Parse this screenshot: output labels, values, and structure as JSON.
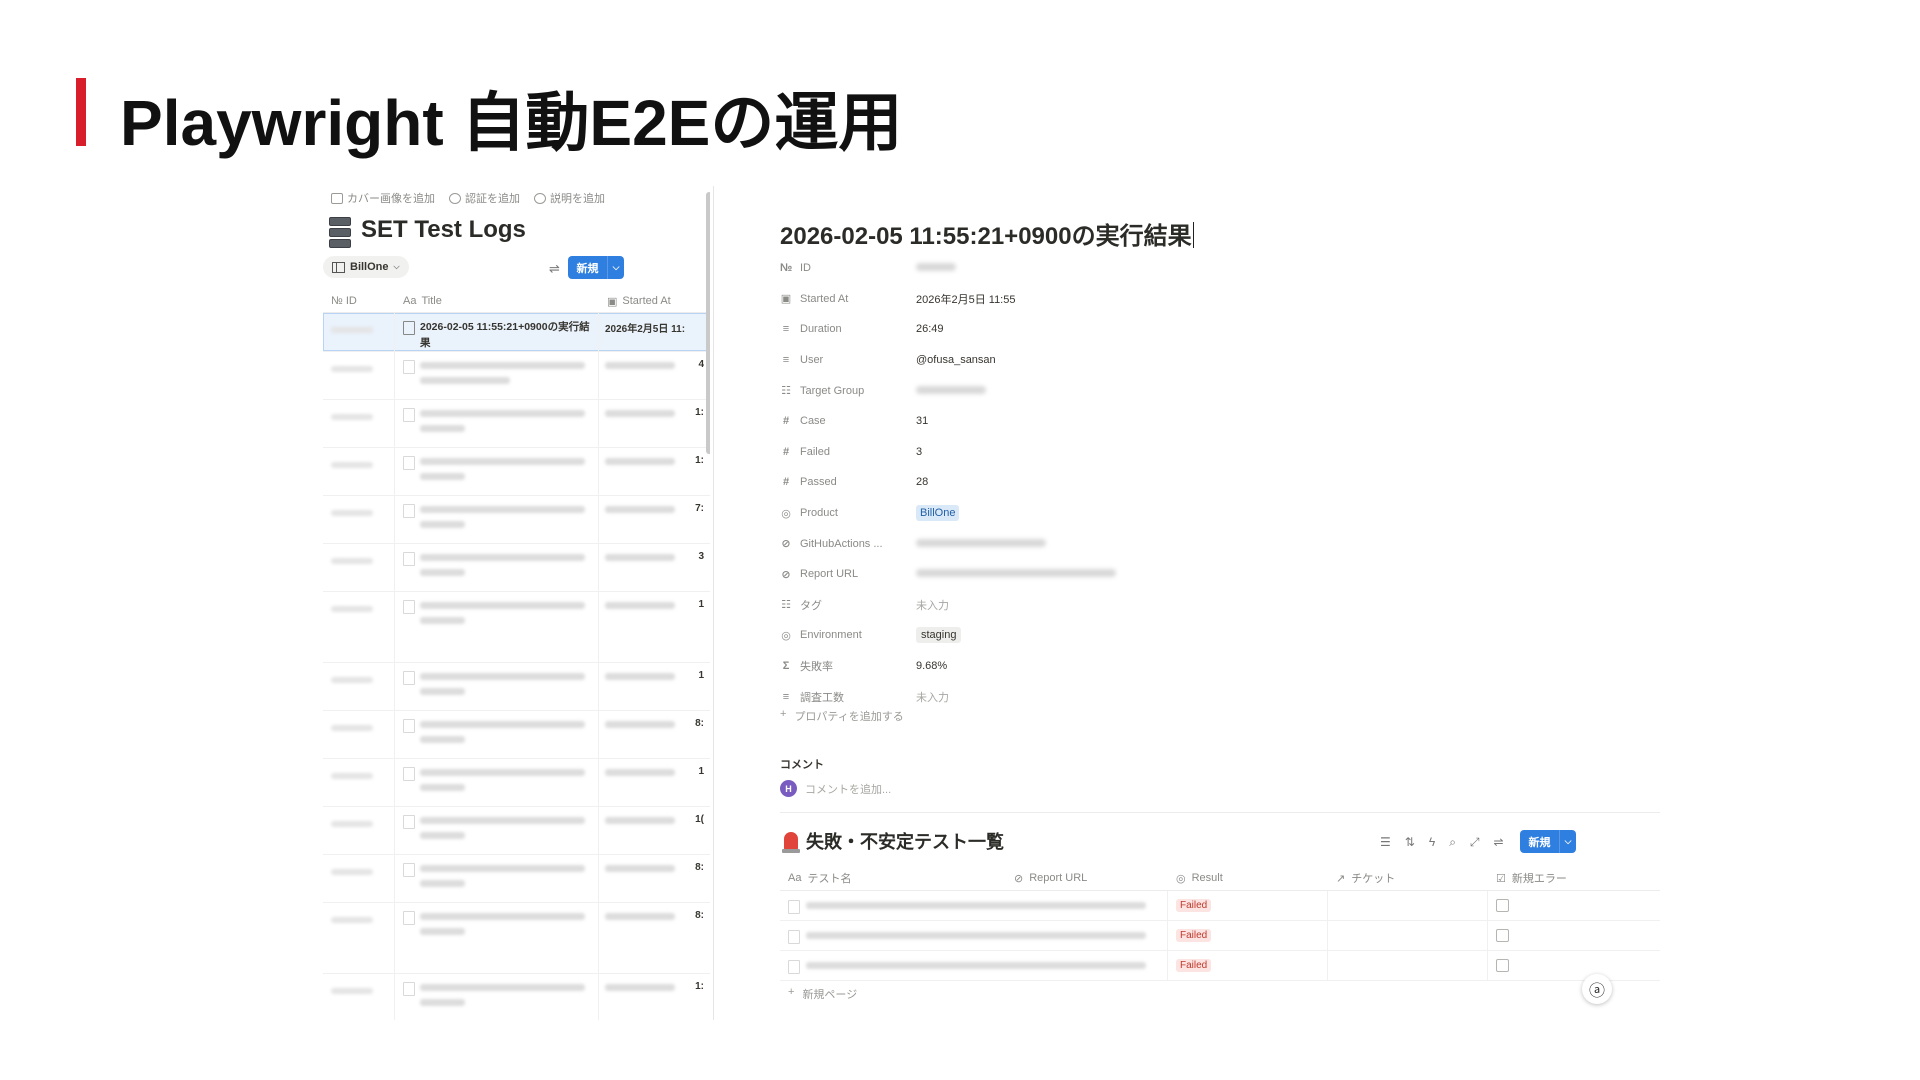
{
  "slide": {
    "title": "Playwright 自動E2Eの運用"
  },
  "left": {
    "page_actions": [
      "カバー画像を追加",
      "認証を追加",
      "説明を追加"
    ],
    "db_title": "SET Test Logs",
    "view_tab": "BillOne",
    "new_button": "新規",
    "columns": [
      "№ ID",
      "Title",
      "Started At"
    ],
    "active_row": {
      "title": "2026-02-05 11:55:21+0900の実行結果",
      "started": "2026年2月5日 11:"
    },
    "blurred_row_tails": [
      "4",
      "1:",
      "1:",
      "7:",
      "3",
      "1",
      "1",
      "8:",
      "1",
      "1(",
      "8:",
      "8:",
      "1:"
    ]
  },
  "right": {
    "title": "2026-02-05 11:55:21+0900の実行結果",
    "properties": [
      {
        "icon": "№",
        "key": "ID",
        "value": "",
        "kind": "blur"
      },
      {
        "icon": "▣",
        "key": "Started At",
        "value": "2026年2月5日 11:55",
        "kind": "text"
      },
      {
        "icon": "≡",
        "key": "Duration",
        "value": "26:49",
        "kind": "text"
      },
      {
        "icon": "≡",
        "key": "User",
        "value": "@ofusa_sansan",
        "kind": "text"
      },
      {
        "icon": "☷",
        "key": "Target Group",
        "value": "",
        "kind": "blur"
      },
      {
        "icon": "#",
        "key": "Case",
        "value": "31",
        "kind": "text"
      },
      {
        "icon": "#",
        "key": "Failed",
        "value": "3",
        "kind": "text"
      },
      {
        "icon": "#",
        "key": "Passed",
        "value": "28",
        "kind": "text"
      },
      {
        "icon": "◎",
        "key": "Product",
        "value": "BillOne",
        "kind": "tag-blue"
      },
      {
        "icon": "⊘",
        "key": "GitHubActions ...",
        "value": "",
        "kind": "blur"
      },
      {
        "icon": "⊘",
        "key": "Report URL",
        "value": "",
        "kind": "blur"
      },
      {
        "icon": "☷",
        "key": "タグ",
        "value": "未入力",
        "kind": "empty"
      },
      {
        "icon": "◎",
        "key": "Environment",
        "value": "staging",
        "kind": "tag-gray"
      },
      {
        "icon": "Σ",
        "key": "失敗率",
        "value": "9.68%",
        "kind": "text"
      },
      {
        "icon": "≡",
        "key": "調査工数",
        "value": "未入力",
        "kind": "empty"
      }
    ],
    "add_property": "プロパティを追加する",
    "comment_label": "コメント",
    "comment_avatar": "H",
    "comment_placeholder": "コメントを追加...",
    "sub_db": {
      "title": "失敗・不安定テスト一覧",
      "new_button": "新規",
      "columns": [
        "テスト名",
        "Report URL",
        "Result",
        "チケット",
        "新規エラー"
      ],
      "rows": [
        {
          "result": "Failed"
        },
        {
          "result": "Failed"
        },
        {
          "result": "Failed"
        }
      ],
      "new_page": "新規ページ"
    }
  }
}
